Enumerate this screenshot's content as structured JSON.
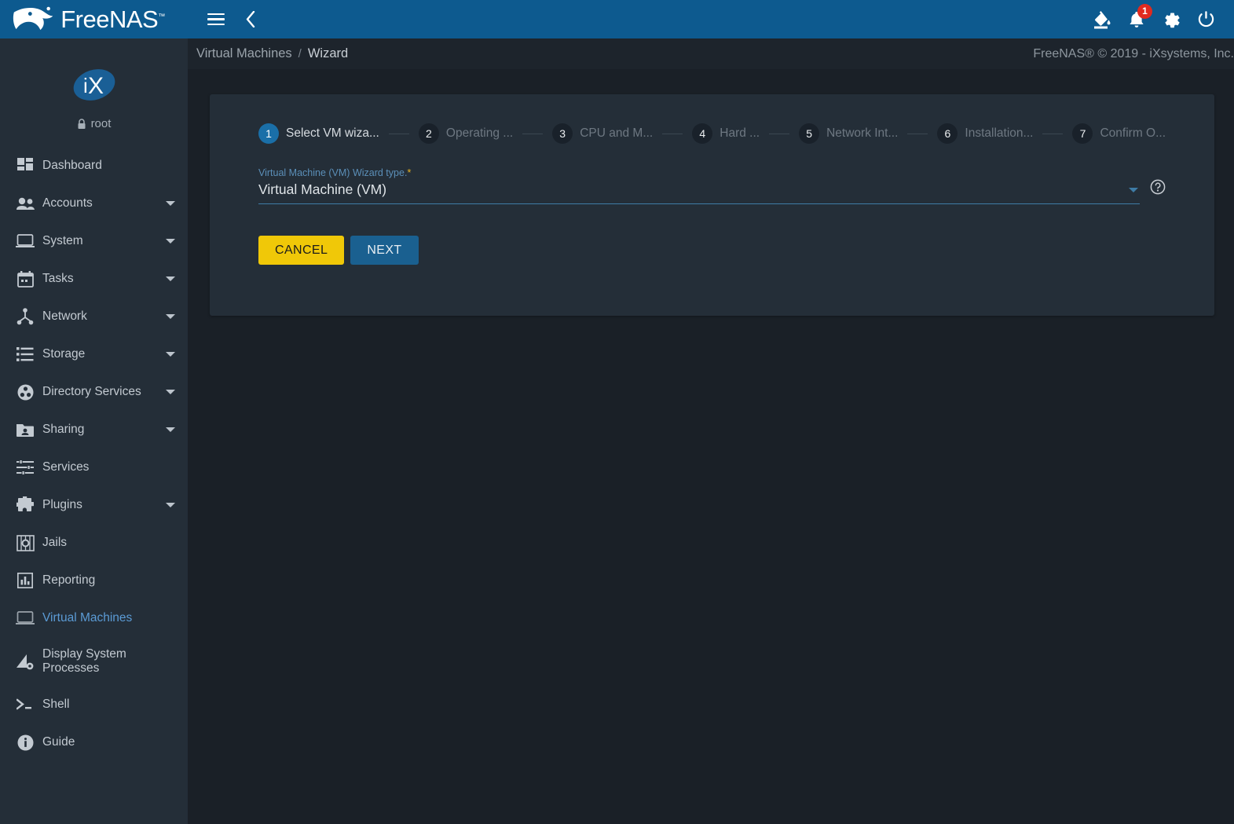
{
  "brand": {
    "name": "FreeNAS",
    "tm": "™"
  },
  "sidebar": {
    "user": {
      "name": "root",
      "lock_icon": "lock-icon"
    },
    "logo_text": "iX",
    "items": [
      {
        "label": "Dashboard",
        "icon": "dashboard-icon",
        "expandable": false,
        "active": false
      },
      {
        "label": "Accounts",
        "icon": "accounts-icon",
        "expandable": true,
        "active": false
      },
      {
        "label": "System",
        "icon": "system-icon",
        "expandable": true,
        "active": false
      },
      {
        "label": "Tasks",
        "icon": "tasks-icon",
        "expandable": true,
        "active": false
      },
      {
        "label": "Network",
        "icon": "network-icon",
        "expandable": true,
        "active": false
      },
      {
        "label": "Storage",
        "icon": "storage-icon",
        "expandable": true,
        "active": false
      },
      {
        "label": "Directory Services",
        "icon": "directory-services-icon",
        "expandable": true,
        "active": false
      },
      {
        "label": "Sharing",
        "icon": "sharing-icon",
        "expandable": true,
        "active": false
      },
      {
        "label": "Services",
        "icon": "services-icon",
        "expandable": false,
        "active": false
      },
      {
        "label": "Plugins",
        "icon": "plugins-icon",
        "expandable": true,
        "active": false
      },
      {
        "label": "Jails",
        "icon": "jails-icon",
        "expandable": false,
        "active": false
      },
      {
        "label": "Reporting",
        "icon": "reporting-icon",
        "expandable": false,
        "active": false
      },
      {
        "label": "Virtual Machines",
        "icon": "virtual-machines-icon",
        "expandable": false,
        "active": true
      },
      {
        "label": "Display System Processes",
        "icon": "display-system-processes-icon",
        "expandable": false,
        "active": false
      },
      {
        "label": "Shell",
        "icon": "shell-icon",
        "expandable": false,
        "active": false
      },
      {
        "label": "Guide",
        "icon": "guide-icon",
        "expandable": false,
        "active": false
      }
    ]
  },
  "topbar": {
    "menu_icon": "hamburger-icon",
    "back_icon": "chevron-left-icon",
    "theme_icon": "paint-bucket-icon",
    "notifications_icon": "bell-icon",
    "notifications_count": "1",
    "settings_icon": "gear-icon",
    "power_icon": "power-icon"
  },
  "breadcrumb": {
    "items": [
      "Virtual Machines",
      "Wizard"
    ],
    "separator": "/",
    "copyright": "FreeNAS® © 2019 - iXsystems, Inc."
  },
  "wizard": {
    "steps": [
      {
        "number": "1",
        "label": "Select VM wiza..."
      },
      {
        "number": "2",
        "label": "Operating ..."
      },
      {
        "number": "3",
        "label": "CPU and M..."
      },
      {
        "number": "4",
        "label": "Hard ..."
      },
      {
        "number": "5",
        "label": "Network Int..."
      },
      {
        "number": "6",
        "label": "Installation..."
      },
      {
        "number": "7",
        "label": "Confirm O..."
      }
    ],
    "active_step_index": 0,
    "field": {
      "label": "Virtual Machine (VM) Wizard type.",
      "required_marker": "*",
      "value": "Virtual Machine (VM)",
      "dropdown_icon": "chevron-down-icon",
      "help_icon": "help-circle-icon"
    },
    "buttons": {
      "cancel": "CANCEL",
      "next": "NEXT"
    }
  },
  "colors": {
    "brand_blue": "#0d5a8f",
    "sidebar_bg": "#242e38",
    "content_bg": "#1a2027",
    "card_bg": "#242e38",
    "accent_active": "#5b9bd5",
    "cancel_yellow": "#f0c808",
    "next_blue": "#1a6090",
    "badge_red": "#e02a1f",
    "required_yellow": "#e8b422",
    "field_underline": "#3e7ca6"
  }
}
